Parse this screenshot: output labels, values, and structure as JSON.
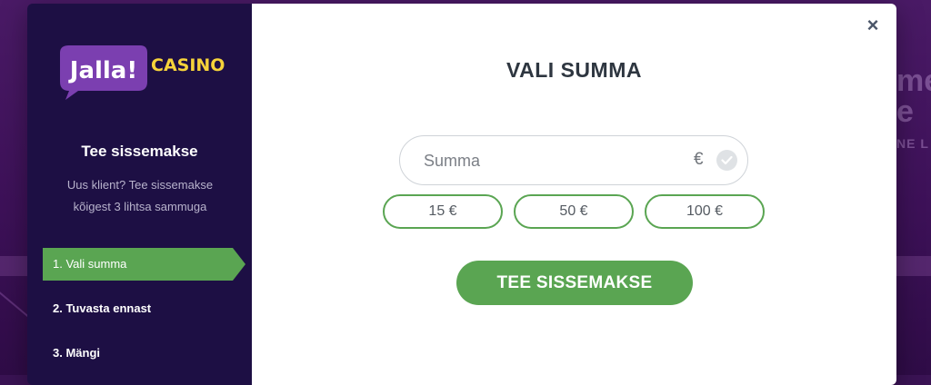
{
  "background": {
    "headline_fragment_1": "me",
    "headline_fragment_2": "e",
    "sub_fragment": "NE L"
  },
  "brand": {
    "logo_word": "Jalla!",
    "logo_suffix": "CASINO"
  },
  "sidebar": {
    "title": "Tee sissemakse",
    "subtitle": "Uus klient? Tee sissemakse kõigest 3 lihtsa sammuga",
    "steps": [
      {
        "label": "1. Vali summa",
        "active": true
      },
      {
        "label": "2. Tuvasta ennast",
        "active": false
      },
      {
        "label": "3. Mängi",
        "active": false
      }
    ]
  },
  "modal": {
    "close_symbol": "×",
    "title": "VALI SUMMA",
    "amount_placeholder": "Summa",
    "amount_value": "",
    "currency_symbol": "€",
    "presets": [
      "15 €",
      "50 €",
      "100 €"
    ],
    "submit_label": "TEE SISSEMAKSE"
  },
  "colors": {
    "accent_green": "#5aa552",
    "sidebar_bg": "#1d0f44",
    "logo_bubble": "#7b3fb0",
    "logo_suffix": "#f6d33a"
  },
  "icons": [
    "close-icon",
    "check-icon",
    "speech-bubble-logo"
  ]
}
